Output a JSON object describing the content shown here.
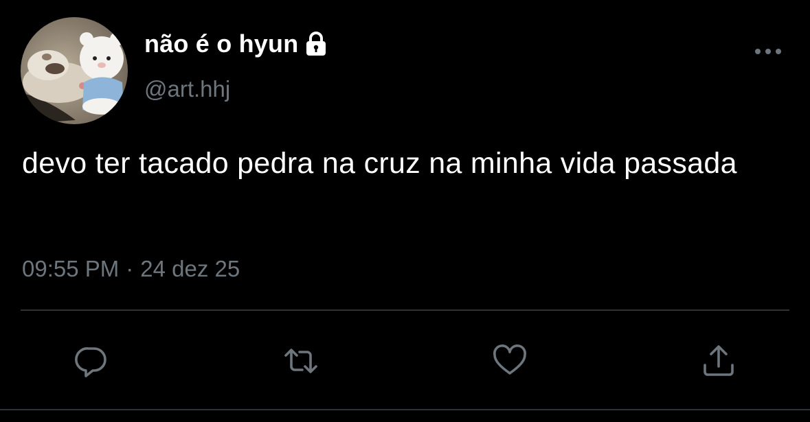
{
  "author": {
    "display_name": "não é o hyun",
    "handle": "@art.hhj",
    "avatar_icon": "avatar-photo",
    "protected_icon": "lock-icon"
  },
  "tweet": {
    "text": "devo ter tacado pedra na cruz na minha vida passada",
    "time": "09:55 PM",
    "separator": "·",
    "date": "24 dez 25"
  },
  "actions": {
    "more_icon": "more-icon",
    "reply_icon": "reply-icon",
    "retweet_icon": "retweet-icon",
    "like_icon": "heart-icon",
    "share_icon": "share-icon"
  },
  "colors": {
    "background": "#000000",
    "primary_text": "#ffffff",
    "secondary_text": "#6e767d",
    "divider": "#2f3336"
  }
}
